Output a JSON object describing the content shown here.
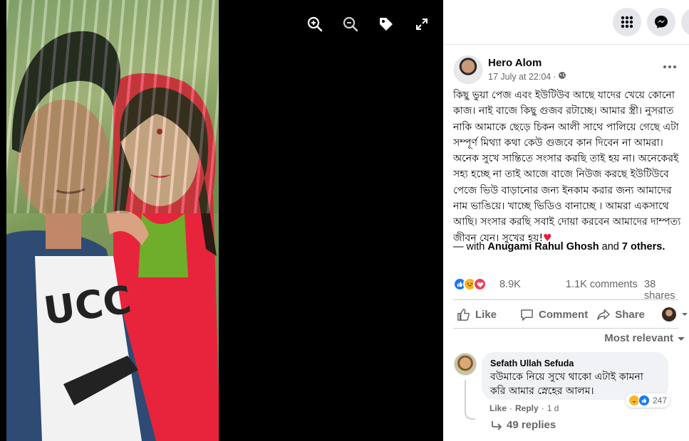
{
  "post": {
    "author": "Hero Alom",
    "timestamp": "17 July at 22:04",
    "body": "কিছু ভুয়া পেজ এবং ইউটিউব আছে যাদের খেয়ে কোনো কাজ। নাই বাজে কিছু গুজব রটাচ্ছে। আমার স্ত্রী। নুসরাত নাকি আমাকে ছেড়ে চিকন আলী সাথে পালিয়ে গেছে এটা সম্পূর্ণ মিথ্যা কথা কেউ গুজবে কান দিবেন না আমরা। অনেক সুখে সান্তিতে সংসার করছি তাই হয় না। অনেকেরই সহ্য হচ্ছে না তাই আজে বাজে নিউজ করছে ইউটিউবে পেজে ভিউ বাড়ানোর জন্য ইনকাম করার জন্য আমাদের নাম ভাঙিয়ে। খাচ্ছে ভিডিও বানাচ্ছে । আমরা একসাথে আছি। সংসার করছি সবাই দোয়া করবেন আমাদের দাম্পত্য জীবন যেন। সুখের হয়!",
    "heart": "♥",
    "with_prefix": "— with",
    "with_person": "Anugami Rahul Ghosh",
    "with_and": "and",
    "with_others": "7 others."
  },
  "stats": {
    "reactions": "8.9K",
    "comments": "1.1K comments",
    "shares": "38 shares"
  },
  "actions": {
    "like": "Like",
    "comment": "Comment",
    "share": "Share"
  },
  "sort": {
    "label": "Most relevant"
  },
  "comment": {
    "author": "Sefath Ullah Sefuda",
    "text": "বউমাকে নিয়ে সুখে থাকো এটাই কামনা করি আমার স্নেহের আলম।",
    "reactions": "247",
    "like": "Like",
    "sep": "·",
    "reply": "Reply",
    "age": "1 d",
    "replies": "49 replies"
  },
  "icons": {
    "zoom_in": "zoom-in-icon",
    "zoom_out": "zoom-out-icon",
    "tag": "tag-icon",
    "fullscreen": "fullscreen-icon",
    "menu": "apps-grid-icon",
    "messenger": "messenger-icon"
  },
  "colors": {
    "accent": "#1877f2",
    "heart": "#e41e3f",
    "secondary_text": "#65676b"
  }
}
